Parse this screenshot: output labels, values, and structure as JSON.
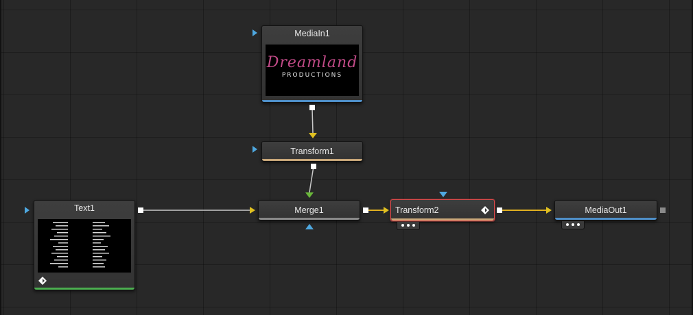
{
  "flow": {
    "nodes": {
      "mediain1": {
        "title": "MediaIn1",
        "thumbnail_script": "Dreamland",
        "thumbnail_sub": "PRODUCTIONS"
      },
      "transform1": {
        "title": "Transform1"
      },
      "text1": {
        "title": "Text1"
      },
      "merge1": {
        "title": "Merge1"
      },
      "transform2": {
        "title": "Transform2",
        "selected": true
      },
      "mediaout1": {
        "title": "MediaOut1"
      }
    },
    "colors": {
      "background": "#282828",
      "node": "#383838",
      "input_port": "#4ea8e0",
      "wire": "#c8c8c8",
      "active_wire": "#e0b020",
      "foreground_port": "#e0c020",
      "mask_port": "#4ea8e0",
      "background_port_green": "#6ab83a",
      "selected_outline": "#d94a4a",
      "bar_blue": "#4f8fc8",
      "bar_tan": "#c9a87a",
      "bar_green": "#4caf50",
      "bar_grey": "#8a8a8a"
    },
    "icons": [
      "input-arrow-icon",
      "output-port-icon",
      "diamond-icon",
      "dots-icon"
    ]
  }
}
